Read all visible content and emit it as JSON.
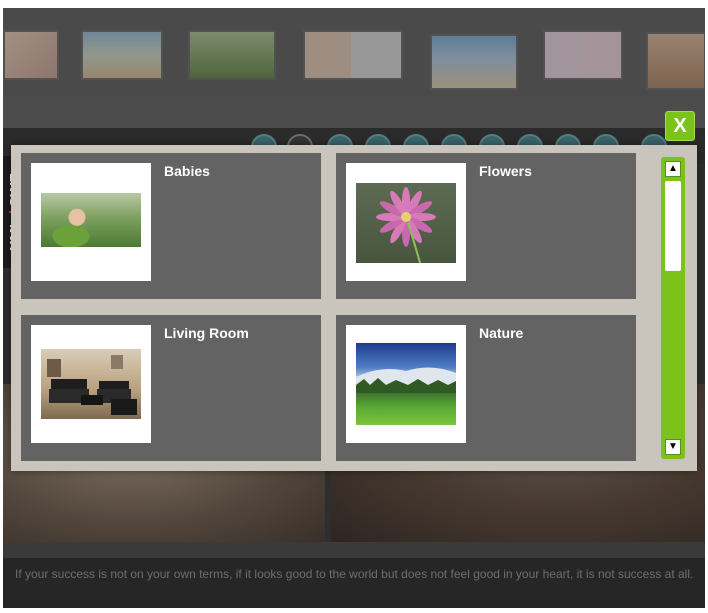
{
  "gallery": {
    "categories": [
      {
        "label": "Babies",
        "icon": "babies-photo"
      },
      {
        "label": "Flowers",
        "icon": "flower-photo"
      },
      {
        "label": "Living Room",
        "icon": "living-room-photo"
      },
      {
        "label": "Nature",
        "icon": "nature-photo"
      }
    ],
    "close_label": "X",
    "side_tab": {
      "left": "XML",
      "slash": "/",
      "right": "SWF"
    },
    "scroll_up_icon": "▲",
    "scroll_down_icon": "▼"
  },
  "caption": {
    "text": "If your success is not on your own terms, if it looks good to the world but does not feel good in your heart, it is not success at all."
  },
  "colors": {
    "accent": "#7bc21b",
    "slash": "#d0296a",
    "card": "#636363",
    "modal": "#c9c5bd"
  }
}
